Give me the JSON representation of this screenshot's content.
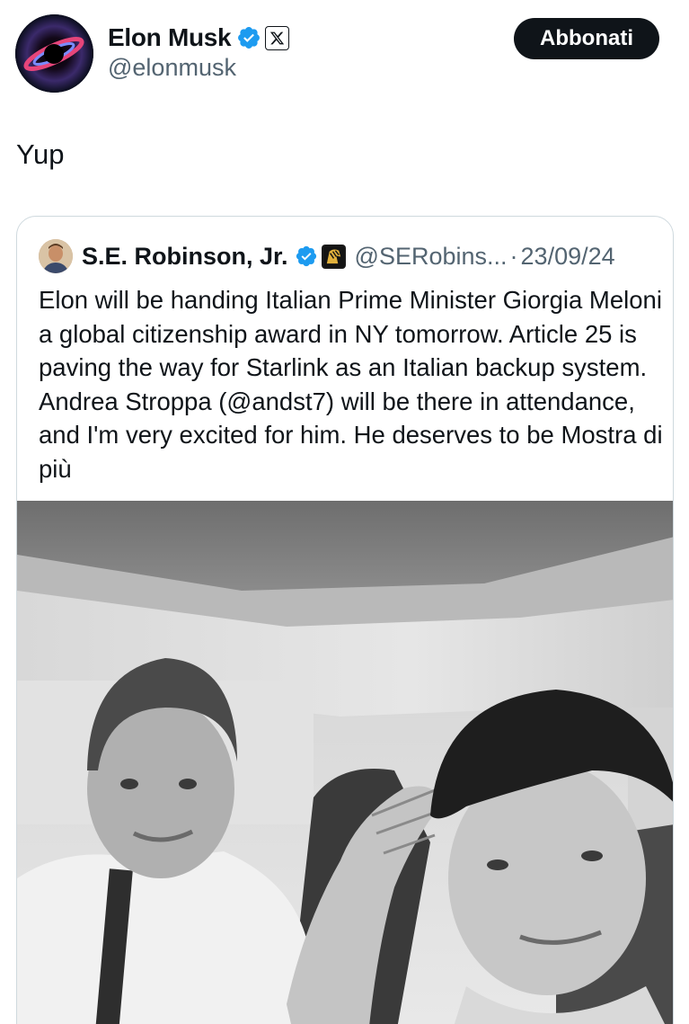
{
  "author": {
    "display_name": "Elon Musk",
    "handle": "@elonmusk",
    "subscribe_label": "Abbonati"
  },
  "tweet": {
    "text": "Yup"
  },
  "quoted_tweet": {
    "display_name": "S.E. Robinson, Jr.",
    "handle": "@SERobins...",
    "separator": "·",
    "date": "23/09/24",
    "text": "Elon will be handing Italian Prime Minister Giorgia Meloni a global citizenship award in NY tomorrow. Article 25 is paving the way for Starlink as an Italian backup system.  Andrea Stroppa (@andst7) will be there in attendance, and I'm very excited for him. He deserves to be Mostra di più"
  },
  "icons": {
    "verified": "verified-badge-icon",
    "x_affiliate": "x-logo-icon",
    "org_affiliate": "lion-logo-icon"
  },
  "colors": {
    "verified_blue": "#1d9bf0",
    "text_primary": "#0f1419",
    "text_secondary": "#536471",
    "border": "#cfd9de",
    "button_bg": "#0f1419"
  }
}
